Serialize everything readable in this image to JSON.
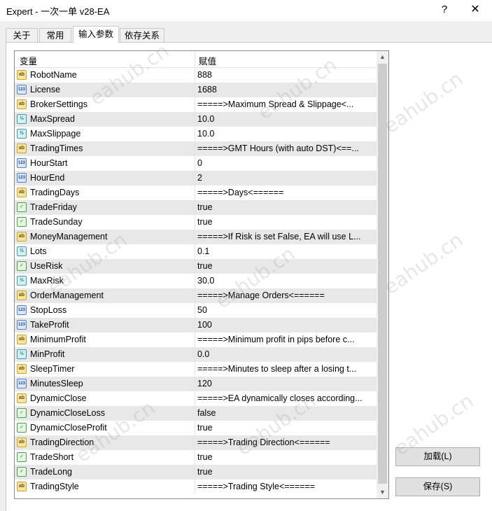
{
  "window": {
    "title": "Expert - 一次一单 v28-EA",
    "help": "?",
    "close": "✕"
  },
  "tabs": [
    {
      "label": "关于"
    },
    {
      "label": "常用"
    },
    {
      "label": "输入参数"
    },
    {
      "label": "依存关系"
    }
  ],
  "grid": {
    "col_variable": "变量",
    "col_value": "赋值",
    "rows": [
      {
        "type": "ab",
        "name": "RobotName",
        "value": "888"
      },
      {
        "type": "123",
        "name": "License",
        "value": "1688"
      },
      {
        "type": "ab",
        "name": "BrokerSettings",
        "value": "=====>Maximum Spread & Slippage<..."
      },
      {
        "type": "v2",
        "name": "MaxSpread",
        "value": "10.0"
      },
      {
        "type": "v2",
        "name": "MaxSlippage",
        "value": "10.0"
      },
      {
        "type": "ab",
        "name": "TradingTimes",
        "value": "=====>GMT Hours (with auto DST)<==..."
      },
      {
        "type": "123",
        "name": "HourStart",
        "value": "0"
      },
      {
        "type": "123",
        "name": "HourEnd",
        "value": "2"
      },
      {
        "type": "ab",
        "name": "TradingDays",
        "value": "=====>Days<======"
      },
      {
        "type": "bool",
        "name": "TradeFriday",
        "value": "true"
      },
      {
        "type": "bool",
        "name": "TradeSunday",
        "value": "true"
      },
      {
        "type": "ab",
        "name": "MoneyManagement",
        "value": "=====>If Risk is set False, EA will use L..."
      },
      {
        "type": "v2",
        "name": "Lots",
        "value": "0.1"
      },
      {
        "type": "bool",
        "name": "UseRisk",
        "value": "true"
      },
      {
        "type": "v2",
        "name": "MaxRisk",
        "value": "30.0"
      },
      {
        "type": "ab",
        "name": "OrderManagement",
        "value": "=====>Manage Orders<======"
      },
      {
        "type": "123",
        "name": "StopLoss",
        "value": "50"
      },
      {
        "type": "123",
        "name": "TakeProfit",
        "value": "100"
      },
      {
        "type": "ab",
        "name": "MinimumProfit",
        "value": "=====>Minimum profit in pips before c..."
      },
      {
        "type": "v2",
        "name": "MinProfit",
        "value": "0.0"
      },
      {
        "type": "ab",
        "name": "SleepTimer",
        "value": "=====>Minutes to sleep after a losing t..."
      },
      {
        "type": "123",
        "name": "MinutesSleep",
        "value": "120"
      },
      {
        "type": "ab",
        "name": "DynamicClose",
        "value": "=====>EA dynamically closes according..."
      },
      {
        "type": "bool",
        "name": "DynamicCloseLoss",
        "value": "false"
      },
      {
        "type": "bool",
        "name": "DynamicCloseProfit",
        "value": "true"
      },
      {
        "type": "ab",
        "name": "TradingDirection",
        "value": "=====>Trading Direction<======"
      },
      {
        "type": "bool",
        "name": "TradeShort",
        "value": "true"
      },
      {
        "type": "bool",
        "name": "TradeLong",
        "value": "true"
      },
      {
        "type": "ab",
        "name": "TradingStyle",
        "value": "=====>Trading Style<======"
      }
    ]
  },
  "buttons": {
    "load": "加载(L)",
    "save": "保存(S)"
  },
  "watermark": "eahub.cn"
}
